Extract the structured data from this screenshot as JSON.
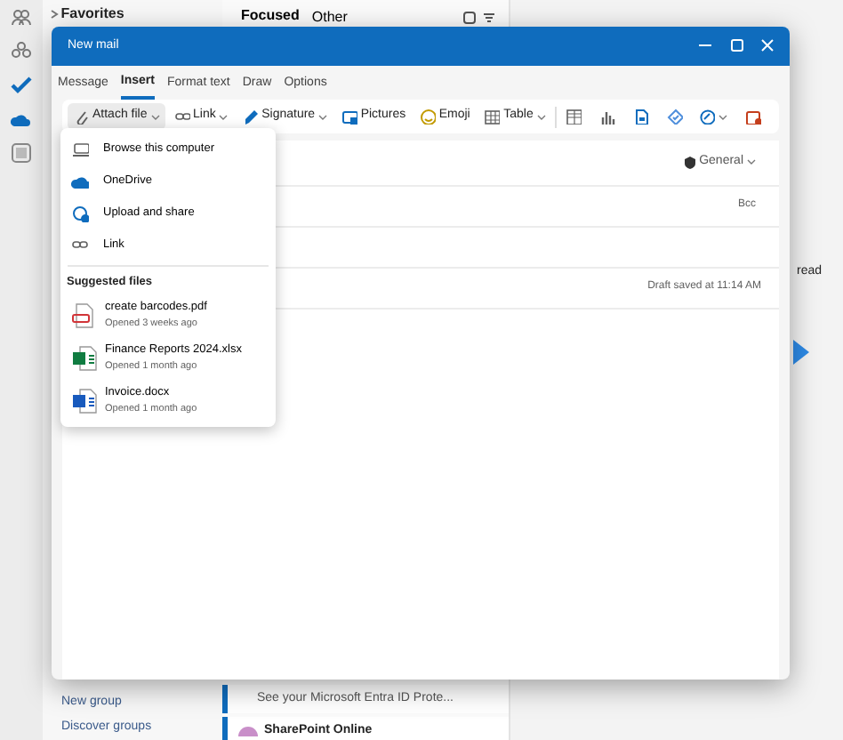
{
  "folder_pane": {
    "favorites": "Favorites",
    "links": [
      "New group",
      "Discover groups"
    ]
  },
  "message_list": {
    "tabs": [
      {
        "label": "Focused",
        "selected": true
      },
      {
        "label": "Other",
        "selected": false
      }
    ],
    "messages": [
      {
        "preview": "See your Microsoft Entra ID Prote..."
      },
      {
        "sender": "SharePoint Online"
      }
    ]
  },
  "reading_pane": {
    "text": "read"
  },
  "window": {
    "title": "New mail",
    "tabs": [
      {
        "label": "Message",
        "selected": false
      },
      {
        "label": "Insert",
        "selected": true
      },
      {
        "label": "Format text",
        "selected": false
      },
      {
        "label": "Draw",
        "selected": false
      },
      {
        "label": "Options",
        "selected": false
      }
    ],
    "toolbar": [
      {
        "kind": "button",
        "label": "Attach file",
        "dropdown": true,
        "active": true
      },
      {
        "kind": "button",
        "label": "Link",
        "dropdown": true,
        "active": false
      },
      {
        "kind": "button",
        "label": "Signature",
        "dropdown": true,
        "active": false
      },
      {
        "kind": "button",
        "label": "Pictures",
        "dropdown": false,
        "active": false
      },
      {
        "kind": "button",
        "label": "Emoji",
        "dropdown": false,
        "active": false
      },
      {
        "kind": "button",
        "label": "Table",
        "dropdown": true,
        "active": false
      },
      {
        "kind": "icon",
        "dropdown": false,
        "active": false
      },
      {
        "kind": "icon",
        "dropdown": false,
        "active": false
      },
      {
        "kind": "icon",
        "dropdown": false,
        "active": false
      },
      {
        "kind": "icon",
        "dropdown": false,
        "active": false
      },
      {
        "kind": "icon",
        "dropdown": true,
        "active": false
      },
      {
        "kind": "icon",
        "dropdown": false,
        "active": false
      }
    ],
    "sensitivity": "General",
    "bcc": "Bcc",
    "draft_status": "Draft saved at 11:14 AM"
  },
  "attach_menu": {
    "items": [
      "Browse this computer",
      "OneDrive",
      "Upload and share",
      "Link"
    ],
    "section": "Suggested files",
    "files": [
      {
        "name": "create barcodes.pdf",
        "opened": "Opened 3 weeks ago"
      },
      {
        "name": "Finance Reports 2024.xlsx",
        "opened": "Opened 1 month ago"
      },
      {
        "name": "Invoice.docx",
        "opened": "Opened 1 month ago"
      }
    ]
  }
}
